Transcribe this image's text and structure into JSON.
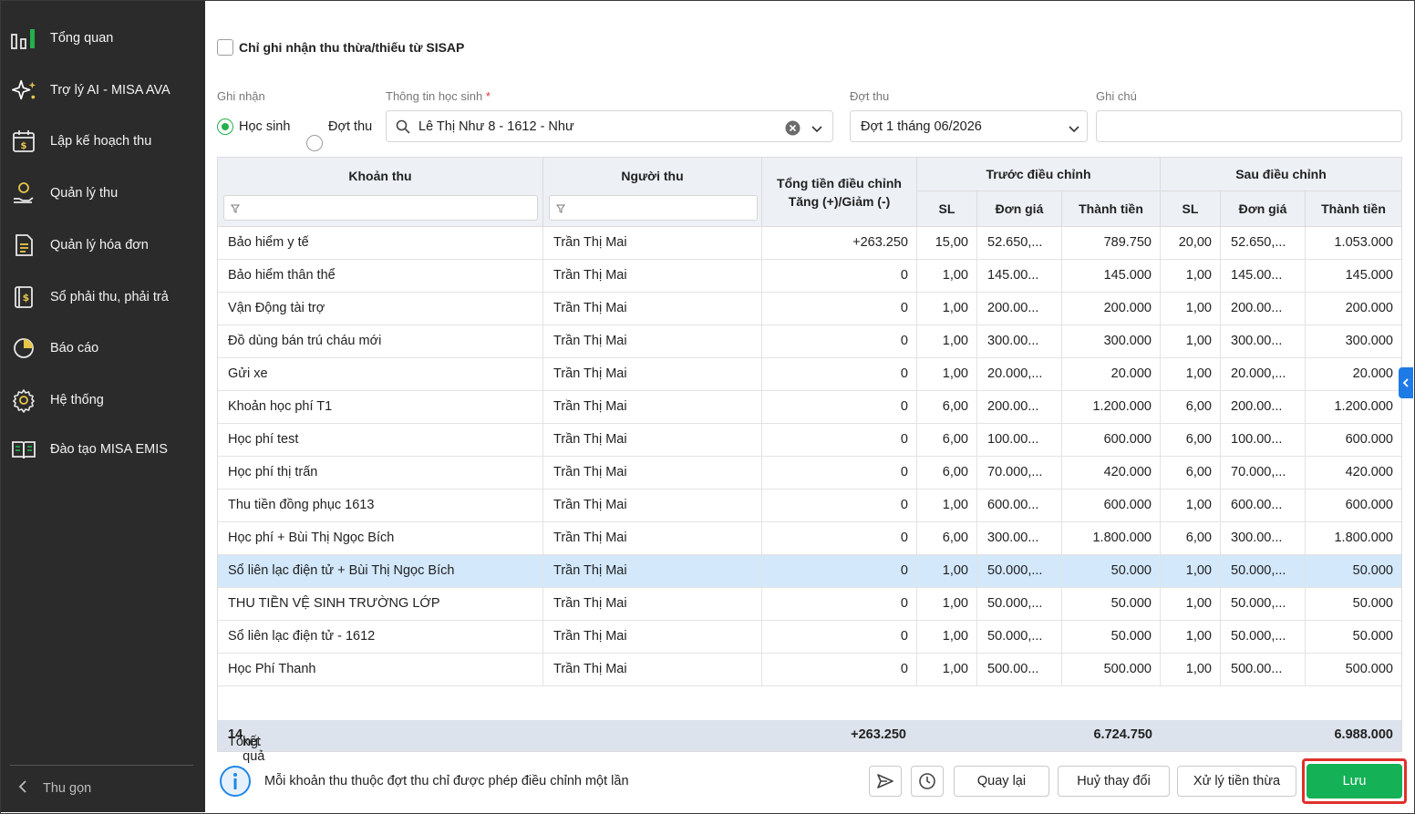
{
  "sidebar": {
    "items": [
      {
        "label": "Tổng quan",
        "icon": "bar-chart-icon"
      },
      {
        "label": "Trợ lý AI - MISA AVA",
        "icon": "sparkle-icon"
      },
      {
        "label": "Lập kế hoạch thu",
        "icon": "calendar-plan-icon"
      },
      {
        "label": "Quản lý thu",
        "icon": "hand-coin-icon"
      },
      {
        "label": "Quản lý hóa đơn",
        "icon": "invoice-icon"
      },
      {
        "label": "Sổ phải thu, phải trả",
        "icon": "ledger-icon"
      },
      {
        "label": "Báo cáo",
        "icon": "pie-chart-icon"
      },
      {
        "label": "Hệ thống",
        "icon": "gear-icon"
      },
      {
        "label": "Đào tạo MISA EMIS",
        "icon": "book-icon"
      }
    ],
    "collapse_label": "Thu gọn"
  },
  "form": {
    "sisap_label": "Chỉ ghi nhận thu thừa/thiếu từ SISAP",
    "ghi_nhan_label": "Ghi nhận",
    "radio_hoc_sinh": "Học sinh",
    "radio_dot_thu": "Đợt thu",
    "student_label": "Thông tin học sinh",
    "student_required": "*",
    "student_value": "Lê Thị Như 8 - 1612 - Như",
    "dot_thu_label": "Đợt thu",
    "dot_thu_value": "Đợt 1 tháng 06/2026",
    "ghi_chu_label": "Ghi chú",
    "ghi_chu_value": ""
  },
  "table": {
    "headers": {
      "khoan_thu": "Khoản thu",
      "nguoi_thu": "Người thu",
      "tong_dieu_chinh": "Tổng tiền điều chỉnh Tăng (+)/Giảm (-)",
      "truoc": "Trước điều chỉnh",
      "sau": "Sau điều chỉnh",
      "sl": "SL",
      "don_gia": "Đơn giá",
      "thanh_tien": "Thành tiền"
    },
    "rows": [
      {
        "khoan_thu": "Bảo hiểm y tế",
        "nguoi_thu": "Trần Thị Mai",
        "dieu_chinh": "+263.250",
        "sl1": "15,00",
        "dg1": "52.650,...",
        "tt1": "789.750",
        "sl2": "20,00",
        "dg2": "52.650,...",
        "tt2": "1.053.000"
      },
      {
        "khoan_thu": "Bảo hiểm thân thể",
        "nguoi_thu": "Trần Thị Mai",
        "dieu_chinh": "0",
        "sl1": "1,00",
        "dg1": "145.00...",
        "tt1": "145.000",
        "sl2": "1,00",
        "dg2": "145.00...",
        "tt2": "145.000"
      },
      {
        "khoan_thu": "Vận Động tài trợ",
        "nguoi_thu": "Trần Thị Mai",
        "dieu_chinh": "0",
        "sl1": "1,00",
        "dg1": "200.00...",
        "tt1": "200.000",
        "sl2": "1,00",
        "dg2": "200.00...",
        "tt2": "200.000"
      },
      {
        "khoan_thu": "Đồ dùng bán trú cháu mới",
        "nguoi_thu": "Trần Thị Mai",
        "dieu_chinh": "0",
        "sl1": "1,00",
        "dg1": "300.00...",
        "tt1": "300.000",
        "sl2": "1,00",
        "dg2": "300.00...",
        "tt2": "300.000"
      },
      {
        "khoan_thu": "Gửi xe",
        "nguoi_thu": "Trần Thị Mai",
        "dieu_chinh": "0",
        "sl1": "1,00",
        "dg1": "20.000,...",
        "tt1": "20.000",
        "sl2": "1,00",
        "dg2": "20.000,...",
        "tt2": "20.000"
      },
      {
        "khoan_thu": "Khoản học phí T1",
        "nguoi_thu": "Trần Thị Mai",
        "dieu_chinh": "0",
        "sl1": "6,00",
        "dg1": "200.00...",
        "tt1": "1.200.000",
        "sl2": "6,00",
        "dg2": "200.00...",
        "tt2": "1.200.000"
      },
      {
        "khoan_thu": "Học phí test",
        "nguoi_thu": "Trần Thị Mai",
        "dieu_chinh": "0",
        "sl1": "6,00",
        "dg1": "100.00...",
        "tt1": "600.000",
        "sl2": "6,00",
        "dg2": "100.00...",
        "tt2": "600.000"
      },
      {
        "khoan_thu": "Học phí thị trấn",
        "nguoi_thu": "Trần Thị Mai",
        "dieu_chinh": "0",
        "sl1": "6,00",
        "dg1": "70.000,...",
        "tt1": "420.000",
        "sl2": "6,00",
        "dg2": "70.000,...",
        "tt2": "420.000"
      },
      {
        "khoan_thu": "Thu tiền đồng phục 1613",
        "nguoi_thu": "Trần Thị Mai",
        "dieu_chinh": "0",
        "sl1": "1,00",
        "dg1": "600.00...",
        "tt1": "600.000",
        "sl2": "1,00",
        "dg2": "600.00...",
        "tt2": "600.000"
      },
      {
        "khoan_thu": "Học phí + Bùi Thị Ngọc Bích",
        "nguoi_thu": "Trần Thị Mai",
        "dieu_chinh": "0",
        "sl1": "6,00",
        "dg1": "300.00...",
        "tt1": "1.800.000",
        "sl2": "6,00",
        "dg2": "300.00...",
        "tt2": "1.800.000"
      },
      {
        "khoan_thu": "Sổ liên lạc điện tử + Bùi Thị Ngọc Bích",
        "nguoi_thu": "Trần Thị Mai",
        "dieu_chinh": "0",
        "sl1": "1,00",
        "dg1": "50.000,...",
        "tt1": "50.000",
        "sl2": "1,00",
        "dg2": "50.000,...",
        "tt2": "50.000"
      },
      {
        "khoan_thu": "THU TIỀN VỆ SINH TRƯỜNG LỚP",
        "nguoi_thu": "Trần Thị Mai",
        "dieu_chinh": "0",
        "sl1": "1,00",
        "dg1": "50.000,...",
        "tt1": "50.000",
        "sl2": "1,00",
        "dg2": "50.000,...",
        "tt2": "50.000"
      },
      {
        "khoan_thu": "Sổ liên lạc điện tử - 1612",
        "nguoi_thu": "Trần Thị Mai",
        "dieu_chinh": "0",
        "sl1": "1,00",
        "dg1": "50.000,...",
        "tt1": "50.000",
        "sl2": "1,00",
        "dg2": "50.000,...",
        "tt2": "50.000"
      },
      {
        "khoan_thu": "Học Phí Thanh",
        "nguoi_thu": "Trần Thị Mai",
        "dieu_chinh": "0",
        "sl1": "1,00",
        "dg1": "500.00...",
        "tt1": "500.000",
        "sl2": "1,00",
        "dg2": "500.00...",
        "tt2": "500.000"
      }
    ],
    "selected_row": 10,
    "footer": {
      "tong_label": "Tổng:",
      "count": "14",
      "ket_qua": "kết quả",
      "dieu_chinh_total": "+263.250",
      "truoc_total": "6.724.750",
      "sau_total": "6.988.000"
    }
  },
  "bottom": {
    "info_text": "Mỗi khoản thu thuộc đợt thu chỉ được phép điều chỉnh một lần",
    "btn_back": "Quay lại",
    "btn_cancel": "Huỷ thay đổi",
    "btn_excess": "Xử lý tiền thừa",
    "btn_save": "Lưu"
  },
  "colors": {
    "sidebar_bg": "#2b2b2b",
    "accent_green": "#14b156",
    "selected_row": "#d3e8fb",
    "highlight_red": "#e0302b",
    "info_blue": "#1e88e5"
  }
}
